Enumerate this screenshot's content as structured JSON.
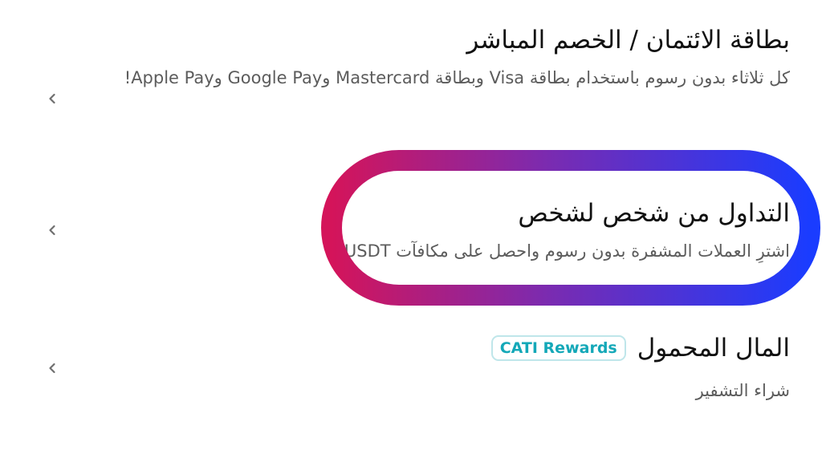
{
  "items": [
    {
      "title": "بطاقة الائتمان / الخصم المباشر",
      "subtitle": "كل ثلاثاء بدون رسوم باستخدام بطاقة Visa وبطاقة Mastercard وGoogle Pay وApple Pay!"
    },
    {
      "title": "التداول من شخص لشخص",
      "subtitle": "اشترِ العملات المشفرة بدون رسوم واحصل على مكافآت USDT!"
    },
    {
      "title": "المال المحمول",
      "badge": "CATI Rewards",
      "subtitle": "شراء التشفير"
    }
  ],
  "icons": {
    "row_chevron": "chevron-left-icon"
  },
  "colors": {
    "highlight_start": "#d4145a",
    "highlight_mid": "#7b2bb0",
    "highlight_end": "#1a3cff",
    "badge_text": "#14a8b8",
    "badge_border": "#bfe6ea",
    "subtitle": "#5c5c5c"
  }
}
